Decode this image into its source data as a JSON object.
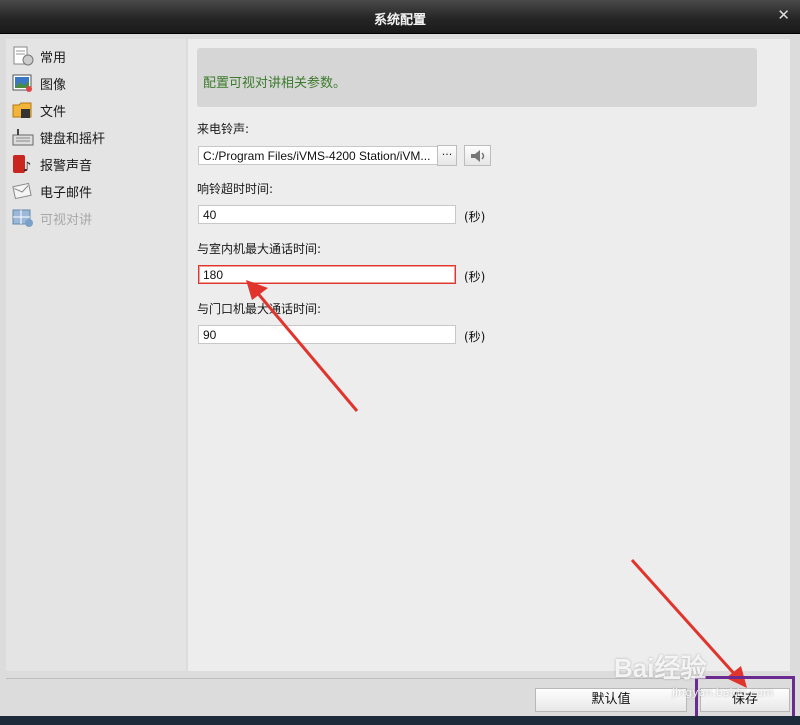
{
  "window": {
    "title": "系统配置",
    "close_glyph": "✕"
  },
  "sidebar": {
    "items": [
      {
        "label": "常用",
        "icon": "general-settings-icon",
        "enabled": true
      },
      {
        "label": "图像",
        "icon": "image-icon",
        "enabled": true
      },
      {
        "label": "文件",
        "icon": "folder-icon",
        "enabled": true
      },
      {
        "label": "键盘和摇杆",
        "icon": "keyboard-icon",
        "enabled": true
      },
      {
        "label": "报警声音",
        "icon": "alarm-sound-icon",
        "enabled": true
      },
      {
        "label": "电子邮件",
        "icon": "email-icon",
        "enabled": true
      },
      {
        "label": "可视对讲",
        "icon": "video-intercom-icon",
        "enabled": false
      }
    ]
  },
  "main": {
    "banner": "配置可视对讲相关参数。",
    "ringtone": {
      "label": "来电铃声:",
      "value": "C:/Program Files/iVMS-4200 Station/iVM...",
      "browse_label": "···"
    },
    "ring_timeout": {
      "label": "响铃超时时间:",
      "value": "40",
      "unit": "(秒)"
    },
    "indoor_max_call": {
      "label": "与室内机最大通话时间:",
      "value": "180",
      "unit": "(秒)"
    },
    "door_max_call": {
      "label": "与门口机最大通话时间:",
      "value": "90",
      "unit": "(秒)"
    }
  },
  "footer": {
    "default_label": "默认值",
    "save_label": "保存"
  },
  "watermark": {
    "text": "Bai经验",
    "sub": "jingyan.baidu.com"
  },
  "colors": {
    "accent_red": "#e0342c",
    "highlight_purple": "#6b2a8f",
    "banner_text": "#3b7a2a"
  }
}
